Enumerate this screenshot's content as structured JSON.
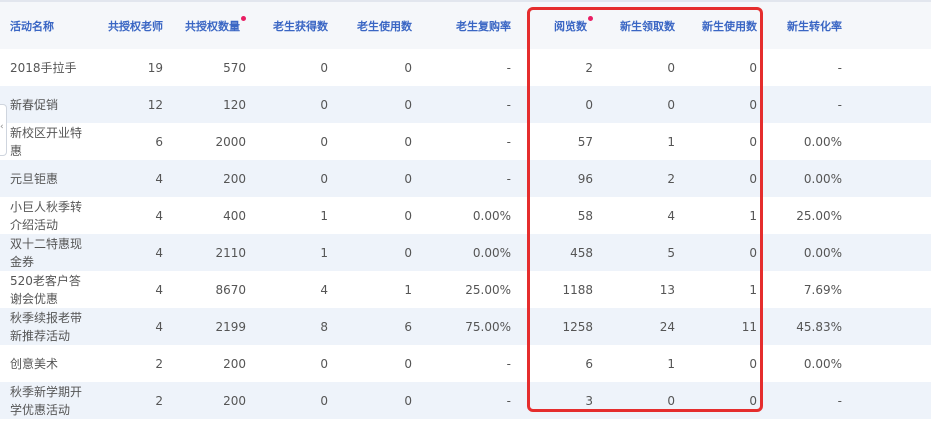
{
  "columns": [
    {
      "key": "name",
      "label": "活动名称",
      "dot": false
    },
    {
      "key": "teachers",
      "label": "共授权老师",
      "dot": false
    },
    {
      "key": "quota",
      "label": "共授权数量",
      "dot": true
    },
    {
      "key": "old_got",
      "label": "老生获得数",
      "dot": false
    },
    {
      "key": "old_used",
      "label": "老生使用数",
      "dot": false
    },
    {
      "key": "old_rebuy",
      "label": "老生复购率",
      "dot": false
    },
    {
      "key": "views",
      "label": "阅览数",
      "dot": true
    },
    {
      "key": "new_claimed",
      "label": "新生领取数",
      "dot": false
    },
    {
      "key": "new_used",
      "label": "新生使用数",
      "dot": false
    },
    {
      "key": "new_conv",
      "label": "新生转化率",
      "dot": false
    }
  ],
  "rows": [
    {
      "name": [
        "2018手拉手"
      ],
      "teachers": "19",
      "quota": "570",
      "old_got": "0",
      "old_used": "0",
      "old_rebuy": "-",
      "views": "2",
      "new_claimed": "0",
      "new_used": "0",
      "new_conv": "-"
    },
    {
      "name": [
        "新春促销"
      ],
      "teachers": "12",
      "quota": "120",
      "old_got": "0",
      "old_used": "0",
      "old_rebuy": "-",
      "views": "0",
      "new_claimed": "0",
      "new_used": "0",
      "new_conv": "-"
    },
    {
      "name": [
        "新校区开业特",
        "惠"
      ],
      "teachers": "6",
      "quota": "2000",
      "old_got": "0",
      "old_used": "0",
      "old_rebuy": "-",
      "views": "57",
      "new_claimed": "1",
      "new_used": "0",
      "new_conv": "0.00%"
    },
    {
      "name": [
        "元旦钜惠"
      ],
      "teachers": "4",
      "quota": "200",
      "old_got": "0",
      "old_used": "0",
      "old_rebuy": "-",
      "views": "96",
      "new_claimed": "2",
      "new_used": "0",
      "new_conv": "0.00%"
    },
    {
      "name": [
        "小巨人秋季转",
        "介绍活动"
      ],
      "teachers": "4",
      "quota": "400",
      "old_got": "1",
      "old_used": "0",
      "old_rebuy": "0.00%",
      "views": "58",
      "new_claimed": "4",
      "new_used": "1",
      "new_conv": "25.00%"
    },
    {
      "name": [
        "双十二特惠现",
        "金券"
      ],
      "teachers": "4",
      "quota": "2110",
      "old_got": "1",
      "old_used": "0",
      "old_rebuy": "0.00%",
      "views": "458",
      "new_claimed": "5",
      "new_used": "0",
      "new_conv": "0.00%"
    },
    {
      "name": [
        "520老客户答",
        "谢会优惠"
      ],
      "teachers": "4",
      "quota": "8670",
      "old_got": "4",
      "old_used": "1",
      "old_rebuy": "25.00%",
      "views": "1188",
      "new_claimed": "13",
      "new_used": "1",
      "new_conv": "7.69%"
    },
    {
      "name": [
        "秋季续报老带",
        "新推荐活动"
      ],
      "teachers": "4",
      "quota": "2199",
      "old_got": "8",
      "old_used": "6",
      "old_rebuy": "75.00%",
      "views": "1258",
      "new_claimed": "24",
      "new_used": "11",
      "new_conv": "45.83%"
    },
    {
      "name": [
        "创意美术"
      ],
      "teachers": "2",
      "quota": "200",
      "old_got": "0",
      "old_used": "0",
      "old_rebuy": "-",
      "views": "6",
      "new_claimed": "1",
      "new_used": "0",
      "new_conv": "0.00%"
    },
    {
      "name": [
        "秋季新学期开",
        "学优惠活动"
      ],
      "teachers": "2",
      "quota": "200",
      "old_got": "0",
      "old_used": "0",
      "old_rebuy": "-",
      "views": "3",
      "new_claimed": "0",
      "new_used": "0",
      "new_conv": "-"
    }
  ],
  "side_handle_icon": "chevron-left-icon",
  "side_handle_glyph": "‹",
  "colors": {
    "header_text": "#3a66c4",
    "highlight": "#e52d2d",
    "dot": "#e91e63",
    "stripe": "#eef3fa"
  }
}
